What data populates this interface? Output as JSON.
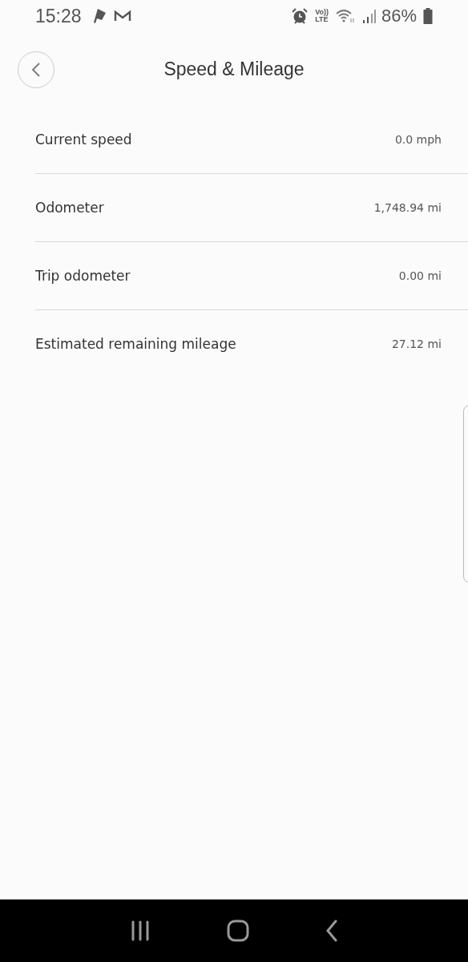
{
  "status_bar": {
    "time": "15:28",
    "volte": [
      "Vo))",
      "LTE"
    ],
    "battery": "86%"
  },
  "header": {
    "title": "Speed & Mileage"
  },
  "rows": [
    {
      "label": "Current speed",
      "value": "0.0 mph"
    },
    {
      "label": "Odometer",
      "value": "1,748.94 mi"
    },
    {
      "label": "Trip odometer",
      "value": "0.00 mi"
    },
    {
      "label": "Estimated remaining mileage",
      "value": "27.12 mi"
    }
  ]
}
